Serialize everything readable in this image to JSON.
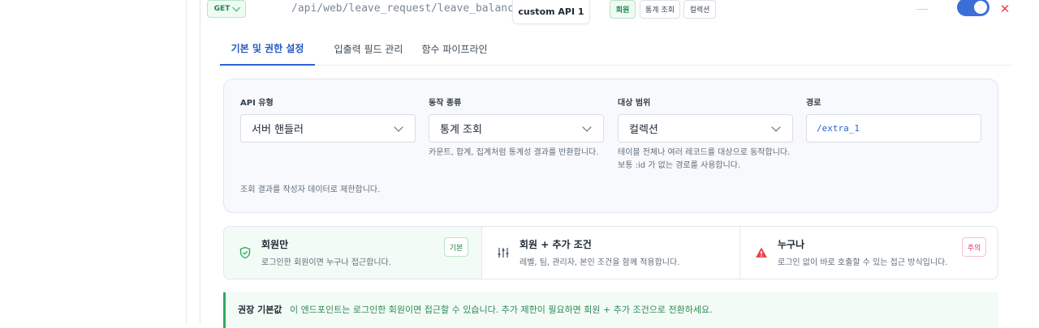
{
  "endpoint": {
    "method": "GET",
    "path": "/api/web/leave_request/leave_balances/",
    "name": "custom API 1",
    "chips": [
      "회원",
      "통계 조회",
      "컬렉션"
    ],
    "enabled": true
  },
  "tabs": [
    {
      "label": "기본 및 권한 설정",
      "active": true
    },
    {
      "label": "입출력 필드 관리",
      "active": false
    },
    {
      "label": "함수 파이프라인",
      "active": false
    }
  ],
  "settings": {
    "api_type": {
      "label": "API 유형",
      "value": "서버 핸들러"
    },
    "action_kind": {
      "label": "동작 종류",
      "value": "통계 조회",
      "help": "카운트, 합계, 집계처럼 통계성 결과를 반환합니다."
    },
    "target_scope": {
      "label": "대상 범위",
      "value": "컬렉션",
      "help_line1": "테이블 전체나 여러 레코드를 대상으로 동작합니다.",
      "help_line2": "보통 :id 가 없는 경로를 사용합니다."
    },
    "route": {
      "label": "경로",
      "value": "/extra_1"
    },
    "note": "조회 결과를 작성자 데이터로 제한합니다."
  },
  "permissions": [
    {
      "title": "회원만",
      "desc": "로그인한 회원이면 누구나 접근합니다.",
      "tag": "기본",
      "icon": "shield-check-icon",
      "selected": true
    },
    {
      "title": "회원 + 추가 조건",
      "desc": "레벨, 팀, 관리자, 본인 조건을 함께 적용합니다.",
      "tag": "",
      "icon": "sliders-icon",
      "selected": false
    },
    {
      "title": "누구나",
      "desc": "로그인 없이 바로 호출할 수 있는 접근 방식입니다.",
      "tag": "주의",
      "icon": "warning-icon",
      "selected": false
    }
  ],
  "recommendation": {
    "title": "권장 기본값",
    "text": "이 엔드포인트는 로그인한 회원이면 접근할 수 있습니다. 추가 제한이 필요하면 회원 + 추가 조건으로 전환하세요."
  },
  "colors": {
    "accent": "#2d63d3",
    "success": "#1e874b",
    "danger": "#e5484d"
  }
}
